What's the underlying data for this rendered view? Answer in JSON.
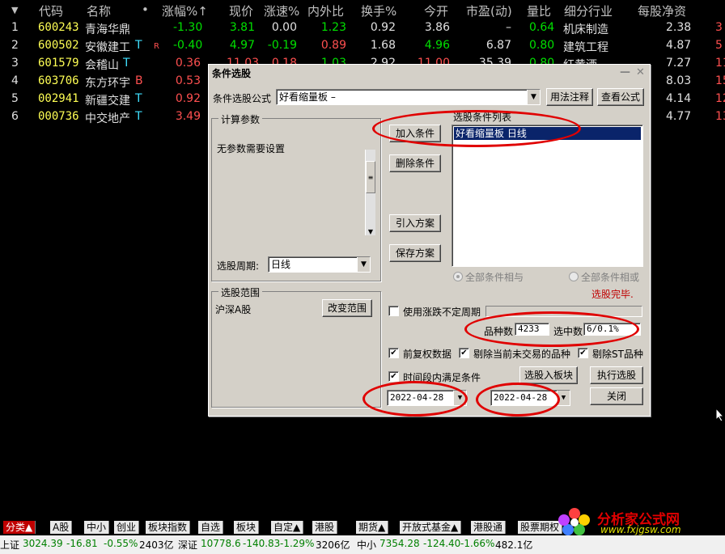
{
  "header": {
    "arrow": "▼",
    "code": "代码",
    "name": "名称",
    "dot": "•",
    "change_pct": "涨幅%↑",
    "price": "现价",
    "speed": "涨速%",
    "ratio": "内外比",
    "turnover": "换手%",
    "open": "今开",
    "pe": "市盈(动)",
    "vol_ratio": "量比",
    "industry": "细分行业",
    "nav": "每股净资"
  },
  "rows": [
    {
      "idx": "1",
      "code": "600243",
      "name": "青海华鼎",
      "mark": "",
      "flag": "",
      "chg": "-1.30",
      "price": "3.81",
      "speed": "0.00",
      "ratio": "1.23",
      "turn": "0.92",
      "open": "3.86",
      "pe": "–",
      "vr": "0.64",
      "ind": "机床制造",
      "nav": "2.38",
      "tail": "3"
    },
    {
      "idx": "2",
      "code": "600502",
      "name": "安徽建工",
      "mark": "T",
      "flag": "R",
      "chg": "-0.40",
      "price": "4.97",
      "speed": "-0.19",
      "ratio": "0.89",
      "turn": "1.68",
      "open": "4.96",
      "pe": "6.87",
      "vr": "0.80",
      "ind": "建筑工程",
      "nav": "4.87",
      "tail": "5"
    },
    {
      "idx": "3",
      "code": "601579",
      "name": "会稽山",
      "mark": "T",
      "flag": "",
      "chg": "0.36",
      "price": "11.03",
      "speed": "0.18",
      "ratio": "1.03",
      "turn": "2.92",
      "open": "11.00",
      "pe": "35.39",
      "vr": "0.80",
      "ind": "红黄酒",
      "nav": "7.27",
      "tail": "11"
    },
    {
      "idx": "4",
      "code": "603706",
      "name": "东方环宇",
      "mark": "B",
      "flag": "",
      "chg": "0.53",
      "price": "",
      "speed": "",
      "ratio": "",
      "turn": "",
      "open": "",
      "pe": "",
      "vr": "",
      "ind": "",
      "nav": "8.03",
      "tail": "15"
    },
    {
      "idx": "5",
      "code": "002941",
      "name": "新疆交建",
      "mark": "T",
      "flag": "",
      "chg": "0.92",
      "price": "",
      "speed": "",
      "ratio": "",
      "turn": "",
      "open": "",
      "pe": "",
      "vr": "",
      "ind": "",
      "nav": "4.14",
      "tail": "12"
    },
    {
      "idx": "6",
      "code": "000736",
      "name": "中交地产",
      "mark": "T",
      "flag": "",
      "chg": "3.49",
      "price": "",
      "speed": "",
      "ratio": "",
      "turn": "",
      "open": "",
      "pe": "",
      "vr": "",
      "ind": "",
      "nav": "4.77",
      "tail": "13"
    }
  ],
  "dialog": {
    "title": "条件选股",
    "min": "—",
    "close": "✕",
    "formula_label": "条件选股公式",
    "formula_value": "好看缩量板   –",
    "usage_btn": "用法注释",
    "view_btn": "查看公式",
    "params_group": "计算参数",
    "params_text": "无参数需要设置",
    "period_label": "选股周期:",
    "period_value": "日线",
    "range_group": "选股范围",
    "range_value": "沪深A股",
    "range_btn": "改变范围",
    "add_btn": "加入条件",
    "del_btn": "删除条件",
    "import_btn": "引入方案",
    "save_btn": "保存方案",
    "cond_list_label": "选股条件列表",
    "cond_item": "好看缩量板  日线",
    "radio_and": "全部条件相与",
    "radio_or": "全部条件相或",
    "done_text": "选股完毕.",
    "use_period": "使用涨跌不定周期",
    "count_label": "品种数",
    "count_value": "4233",
    "selected_label": "选中数",
    "selected_value": "6/0.1%",
    "prefq": "前复权数据",
    "exclude_untraded": "剔除当前未交易的品种",
    "exclude_st": "剔除ST品种",
    "time_cond": "时间段内满足条件",
    "to_block_btn": "选股入板块",
    "exec_btn": "执行选股",
    "date_from": "2022-04-28",
    "date_to": "2022-04-28",
    "close_btn": "关闭"
  },
  "tabs": [
    "分类▲",
    "A股",
    "中小",
    "创业",
    "板块指数",
    "自选",
    "板块",
    "自定▲",
    "港股",
    "期货▲",
    "开放式基金▲",
    "港股通",
    "股票期权"
  ],
  "status": {
    "sh_label": "上证",
    "sh_value": "3024.39",
    "sh_chg": "-16.81",
    "sh_pct": "-0.55%",
    "sh_vol": "2403亿",
    "sz_label": "深证",
    "sz_value": "10778.6",
    "sz_chg": "-140.83",
    "sz_pct": "-1.29%",
    "sz_vol": "3206亿",
    "zx_label": "中小",
    "zx_value": "7354.28",
    "zx_chg": "-124.40",
    "zx_pct": "-1.66%",
    "zx_vol": "482.1亿"
  },
  "logo": {
    "name": "分析家公式网",
    "url": "www.fxjgsw.com"
  },
  "colors": {
    "accent_red": "#e00000",
    "up": "#ff5050",
    "down": "#00e000",
    "code": "#ffff54"
  }
}
